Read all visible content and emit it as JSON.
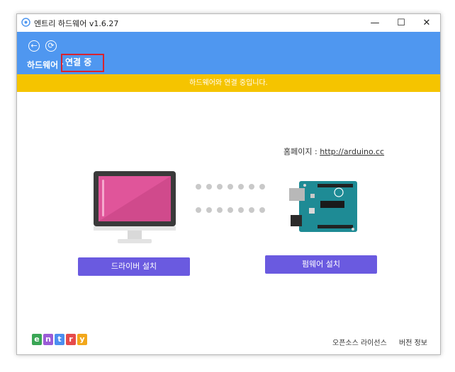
{
  "window": {
    "title": "엔트리 하드웨어 v1.6.27",
    "minimize_glyph": "—",
    "maximize_glyph": "☐",
    "close_glyph": "✕"
  },
  "header": {
    "back_icon": "←",
    "refresh_icon": "⟳",
    "breadcrumb_home": "하드웨어",
    "breadcrumb_separator": "›",
    "breadcrumb_current": "연결 중"
  },
  "banner": {
    "text": "하드웨어와 연결 중입니다."
  },
  "content": {
    "homepage_label": "홈페이지 :",
    "homepage_link": "http://arduino.cc",
    "driver_button": "드라이버 설치",
    "firmware_button": "펌웨어 설치"
  },
  "footer": {
    "logo_letters": [
      "e",
      "n",
      "t",
      "r",
      "y"
    ],
    "logo_colors": [
      "#3aa655",
      "#9b5cd6",
      "#4c8ef0",
      "#e64b4b",
      "#f2a71b"
    ],
    "open_source_license": "오픈소스 라이선스",
    "version_info": "버전 정보"
  },
  "colors": {
    "header_blue": "#4f97f0",
    "banner_yellow": "#f5c400",
    "button_purple": "#6a5ae0",
    "highlight_red": "#d9232e"
  }
}
